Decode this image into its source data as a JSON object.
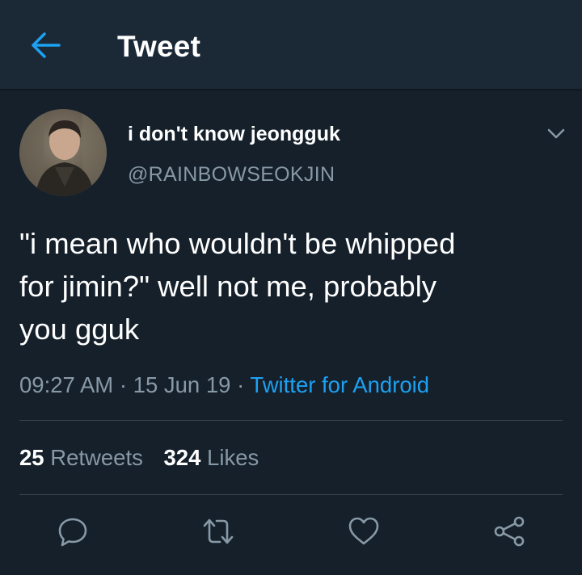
{
  "header": {
    "title": "Tweet",
    "back_icon": "arrow-left-icon"
  },
  "author": {
    "display_name": "i don't know jeongguk",
    "handle": "@RAINBOWSEOKJIN",
    "avatar": "profile-photo",
    "menu_icon": "chevron-down-icon"
  },
  "tweet": {
    "text": "\"i mean who wouldn't be whipped\nfor jimin?\" well not me, probably\nyou gguk",
    "time": "09:27 AM",
    "date": "15 Jun 19",
    "separator": "·",
    "source": "Twitter for Android"
  },
  "stats": {
    "retweets_count": "25",
    "retweets_label": "Retweets",
    "likes_count": "324",
    "likes_label": "Likes"
  },
  "actions": {
    "reply_icon": "reply-icon",
    "retweet_icon": "retweet-icon",
    "like_icon": "heart-icon",
    "share_icon": "share-icon"
  },
  "colors": {
    "background": "#15202b",
    "header_background": "#1b2836",
    "accent": "#1da1f2",
    "secondary_text": "#8899a6",
    "divider": "#38444d"
  }
}
